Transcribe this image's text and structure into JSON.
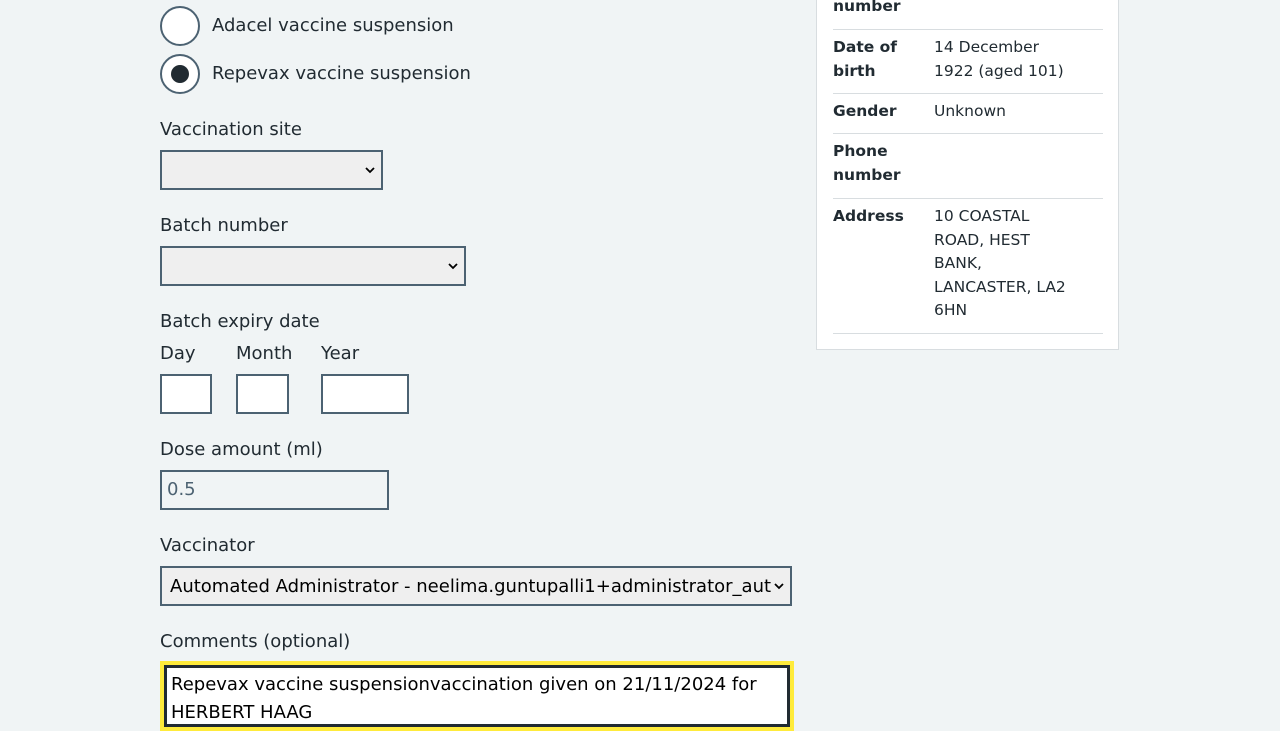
{
  "vaccine_options": [
    {
      "label": "Adacel vaccine suspension",
      "checked": false
    },
    {
      "label": "Repevax vaccine suspension",
      "checked": true
    }
  ],
  "vaccination_site": {
    "label": "Vaccination site",
    "value": ""
  },
  "batch_number": {
    "label": "Batch number",
    "value": ""
  },
  "batch_expiry": {
    "label": "Batch expiry date",
    "day_label": "Day",
    "month_label": "Month",
    "year_label": "Year",
    "day_value": "",
    "month_value": "",
    "year_value": ""
  },
  "dose_amount": {
    "label": "Dose amount (ml)",
    "value": "0.5"
  },
  "vaccinator": {
    "label": "Vaccinator",
    "value": "Automated Administrator - neelima.guntupalli1+administrator_aut"
  },
  "comments": {
    "label": "Comments (optional)",
    "value": "Repevax vaccine suspensionvaccination given on 21/11/2024 for HERBERT HAAG"
  },
  "patient_details": {
    "nhs_number_key_tail": "number",
    "dob_key": "Date of birth",
    "dob_value": "14 December 1922 (aged 101)",
    "gender_key": "Gender",
    "gender_value": "Unknown",
    "phone_key": "Phone number",
    "phone_value": "",
    "address_key": "Address",
    "address_value": "10 COASTAL ROAD, HEST BANK, LANCASTER, LA2 6HN"
  }
}
